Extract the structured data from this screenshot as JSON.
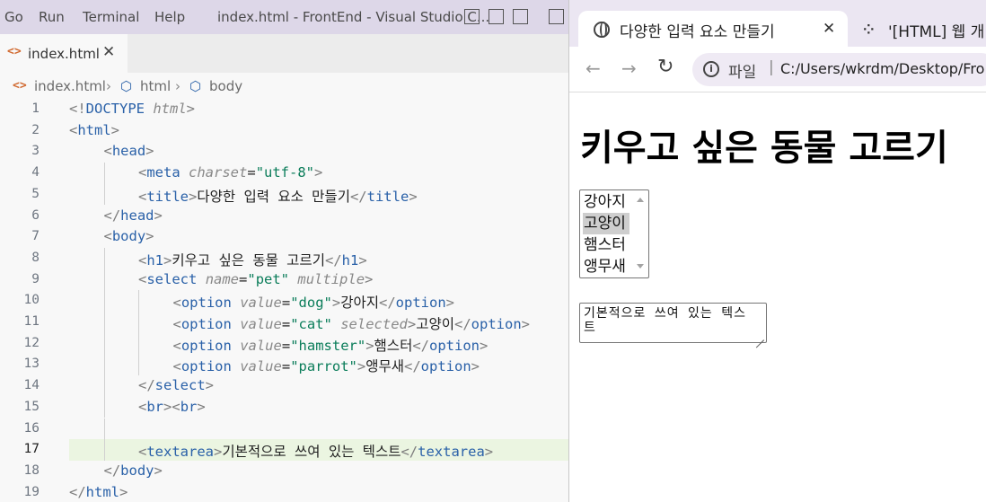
{
  "vscode": {
    "menu": [
      "Go",
      "Run",
      "Terminal",
      "Help"
    ],
    "title": "index.html - FrontEnd - Visual Studio C...",
    "tab": {
      "label": "index.html",
      "close": "✕"
    },
    "breadcrumb": [
      "index.html",
      "html",
      "body"
    ],
    "active_line": 17,
    "lines": [
      {
        "n": "1",
        "indent": 0,
        "tokens": [
          [
            "br",
            "<!"
          ],
          [
            "tag",
            "DOCTYPE"
          ],
          [
            "txt",
            " "
          ],
          [
            "attr",
            "html"
          ],
          [
            "br",
            ">"
          ]
        ]
      },
      {
        "n": "2",
        "indent": 0,
        "tokens": [
          [
            "br",
            "<"
          ],
          [
            "tag",
            "html"
          ],
          [
            "br",
            ">"
          ]
        ]
      },
      {
        "n": "3",
        "indent": 1,
        "tokens": [
          [
            "br",
            "<"
          ],
          [
            "tag",
            "head"
          ],
          [
            "br",
            ">"
          ]
        ]
      },
      {
        "n": "4",
        "indent": 2,
        "tokens": [
          [
            "br",
            "<"
          ],
          [
            "tag",
            "meta"
          ],
          [
            "txt",
            " "
          ],
          [
            "attr",
            "charset"
          ],
          [
            "txt",
            "="
          ],
          [
            "str",
            "\"utf-8\""
          ],
          [
            "br",
            ">"
          ]
        ]
      },
      {
        "n": "5",
        "indent": 2,
        "tokens": [
          [
            "br",
            "<"
          ],
          [
            "tag",
            "title"
          ],
          [
            "br",
            ">"
          ],
          [
            "txt",
            "다양한 입력 요소 만들기"
          ],
          [
            "br",
            "</"
          ],
          [
            "tag",
            "title"
          ],
          [
            "br",
            ">"
          ]
        ]
      },
      {
        "n": "6",
        "indent": 1,
        "tokens": [
          [
            "br",
            "</"
          ],
          [
            "tag",
            "head"
          ],
          [
            "br",
            ">"
          ]
        ]
      },
      {
        "n": "7",
        "indent": 1,
        "tokens": [
          [
            "br",
            "<"
          ],
          [
            "tag",
            "body"
          ],
          [
            "br",
            ">"
          ]
        ]
      },
      {
        "n": "8",
        "indent": 2,
        "tokens": [
          [
            "br",
            "<"
          ],
          [
            "tag",
            "h1"
          ],
          [
            "br",
            ">"
          ],
          [
            "txt",
            "키우고 싶은 동물 고르기"
          ],
          [
            "br",
            "</"
          ],
          [
            "tag",
            "h1"
          ],
          [
            "br",
            ">"
          ]
        ]
      },
      {
        "n": "9",
        "indent": 2,
        "tokens": [
          [
            "br",
            "<"
          ],
          [
            "tag",
            "select"
          ],
          [
            "txt",
            " "
          ],
          [
            "attr",
            "name"
          ],
          [
            "txt",
            "="
          ],
          [
            "str",
            "\"pet\""
          ],
          [
            "txt",
            " "
          ],
          [
            "attr",
            "multiple"
          ],
          [
            "br",
            ">"
          ]
        ]
      },
      {
        "n": "10",
        "indent": 3,
        "tokens": [
          [
            "br",
            "<"
          ],
          [
            "tag",
            "option"
          ],
          [
            "txt",
            " "
          ],
          [
            "attr",
            "value"
          ],
          [
            "txt",
            "="
          ],
          [
            "str",
            "\"dog\""
          ],
          [
            "br",
            ">"
          ],
          [
            "txt",
            "강아지"
          ],
          [
            "br",
            "</"
          ],
          [
            "tag",
            "option"
          ],
          [
            "br",
            ">"
          ]
        ]
      },
      {
        "n": "11",
        "indent": 3,
        "tokens": [
          [
            "br",
            "<"
          ],
          [
            "tag",
            "option"
          ],
          [
            "txt",
            " "
          ],
          [
            "attr",
            "value"
          ],
          [
            "txt",
            "="
          ],
          [
            "str",
            "\"cat\""
          ],
          [
            "txt",
            " "
          ],
          [
            "attr",
            "selected"
          ],
          [
            "br",
            ">"
          ],
          [
            "txt",
            "고양이"
          ],
          [
            "br",
            "</"
          ],
          [
            "tag",
            "option"
          ],
          [
            "br",
            ">"
          ]
        ]
      },
      {
        "n": "12",
        "indent": 3,
        "tokens": [
          [
            "br",
            "<"
          ],
          [
            "tag",
            "option"
          ],
          [
            "txt",
            " "
          ],
          [
            "attr",
            "value"
          ],
          [
            "txt",
            "="
          ],
          [
            "str",
            "\"hamster\""
          ],
          [
            "br",
            ">"
          ],
          [
            "txt",
            "햄스터"
          ],
          [
            "br",
            "</"
          ],
          [
            "tag",
            "option"
          ],
          [
            "br",
            ">"
          ]
        ]
      },
      {
        "n": "13",
        "indent": 3,
        "tokens": [
          [
            "br",
            "<"
          ],
          [
            "tag",
            "option"
          ],
          [
            "txt",
            " "
          ],
          [
            "attr",
            "value"
          ],
          [
            "txt",
            "="
          ],
          [
            "str",
            "\"parrot\""
          ],
          [
            "br",
            ">"
          ],
          [
            "txt",
            "앵무새"
          ],
          [
            "br",
            "</"
          ],
          [
            "tag",
            "option"
          ],
          [
            "br",
            ">"
          ]
        ]
      },
      {
        "n": "14",
        "indent": 2,
        "tokens": [
          [
            "br",
            "</"
          ],
          [
            "tag",
            "select"
          ],
          [
            "br",
            ">"
          ]
        ]
      },
      {
        "n": "15",
        "indent": 2,
        "tokens": [
          [
            "br",
            "<"
          ],
          [
            "tag",
            "br"
          ],
          [
            "br",
            "><"
          ],
          [
            "tag",
            "br"
          ],
          [
            "br",
            ">"
          ]
        ]
      },
      {
        "n": "16",
        "indent": 2,
        "tokens": []
      },
      {
        "n": "17",
        "indent": 2,
        "tokens": [
          [
            "br",
            "<"
          ],
          [
            "tag",
            "textarea"
          ],
          [
            "br",
            ">"
          ],
          [
            "txt",
            "기본적으로 쓰여 있는 텍스트"
          ],
          [
            "br",
            "</"
          ],
          [
            "tag",
            "textarea"
          ],
          [
            "br",
            ">"
          ]
        ]
      },
      {
        "n": "18",
        "indent": 1,
        "tokens": [
          [
            "br",
            "</"
          ],
          [
            "tag",
            "body"
          ],
          [
            "br",
            ">"
          ]
        ]
      },
      {
        "n": "19",
        "indent": 0,
        "tokens": [
          [
            "br",
            "</"
          ],
          [
            "tag",
            "html"
          ],
          [
            "br",
            ">"
          ]
        ]
      }
    ]
  },
  "browser": {
    "active_tab_title": "다양한 입력 요소 만들기",
    "active_tab_close": "✕",
    "second_tab_title": "'[HTML] 웹 개",
    "omnibox": {
      "chip": "파일",
      "separator": "|",
      "url": "C:/Users/wkrdm/Desktop/Fro"
    },
    "page": {
      "heading": "키우고 싶은 동물 고르기",
      "select_options": [
        {
          "label": "강아지",
          "selected": false
        },
        {
          "label": "고양이",
          "selected": true
        },
        {
          "label": "햄스터",
          "selected": false
        },
        {
          "label": "앵무새",
          "selected": false
        }
      ],
      "textarea_value": "기본적으로 쓰여 있는 텍스트"
    }
  }
}
